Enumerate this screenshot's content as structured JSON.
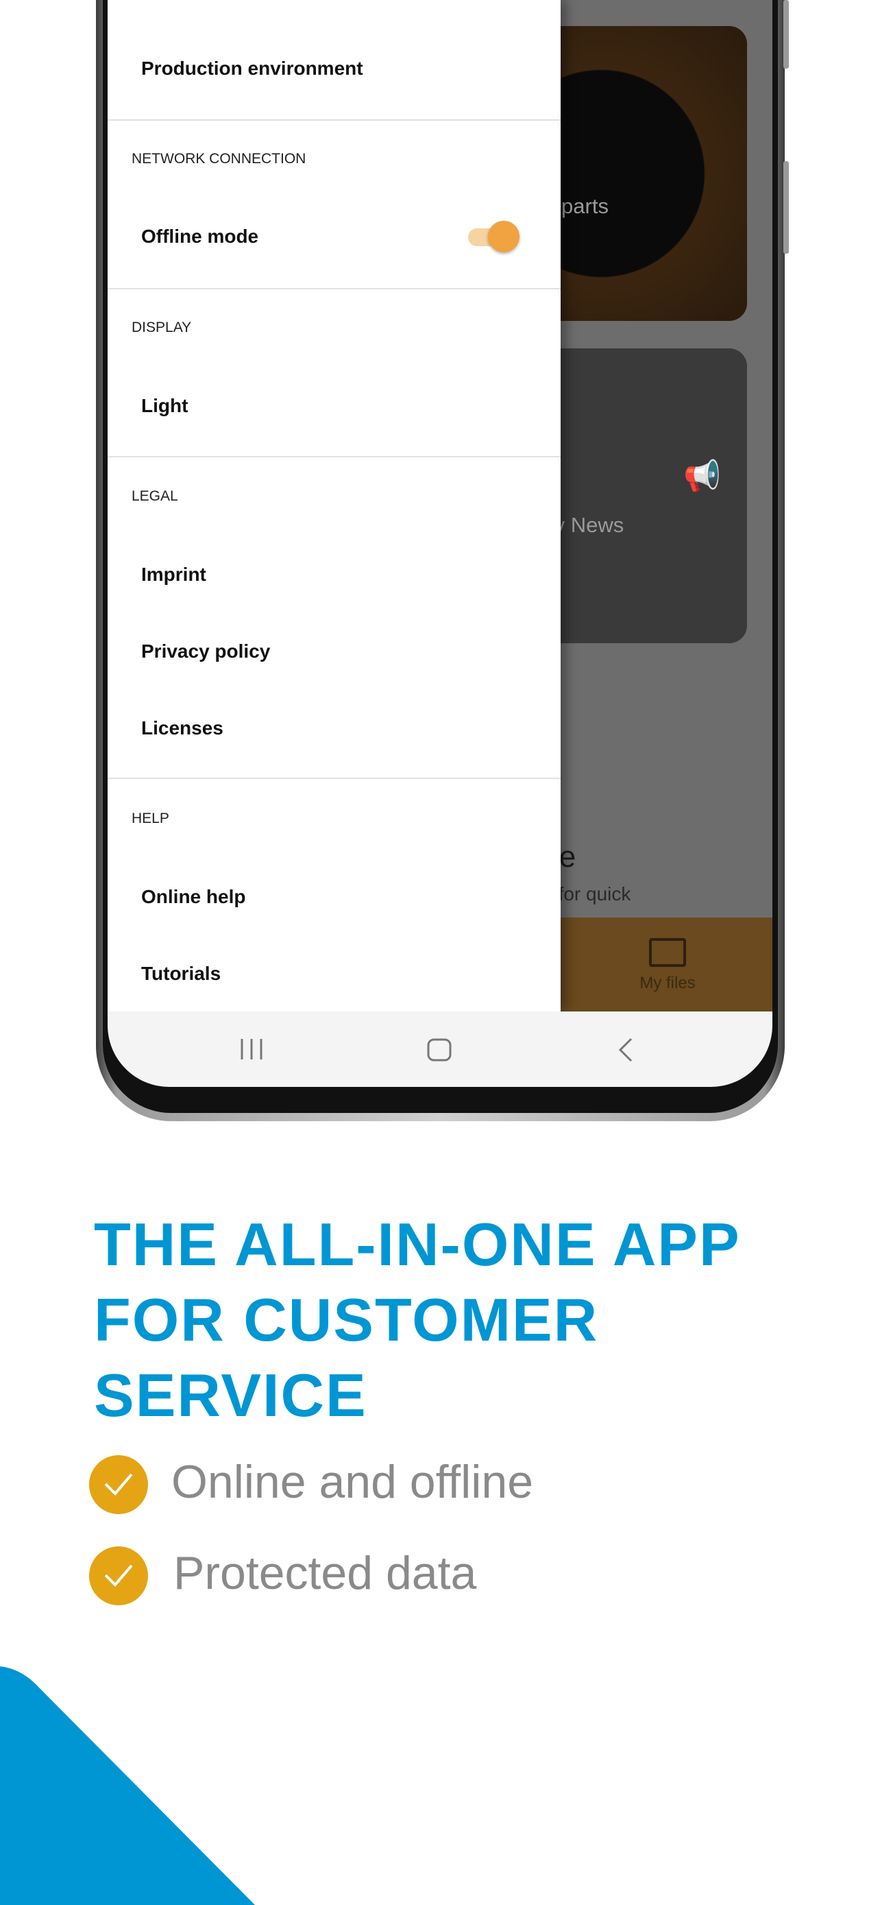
{
  "drawer": {
    "top_item": "Production environment",
    "sections": [
      {
        "header": "NETWORK CONNECTION",
        "items": [
          "Offline mode"
        ]
      },
      {
        "header": "DISPLAY",
        "items": [
          "Light"
        ]
      },
      {
        "header": "LEGAL",
        "items": [
          "Imprint",
          "Privacy policy",
          "Licenses"
        ]
      },
      {
        "header": "HELP",
        "items": [
          "Online help",
          "Tutorials"
        ]
      }
    ],
    "offline_mode_enabled": true
  },
  "background_app": {
    "card1_label": "pareparts",
    "card2_label": "ustry News",
    "partial_title": "able",
    "partial_text": "files for quick",
    "bottom_tab": "My files"
  },
  "navbar": {
    "icons": [
      "recent-apps-icon",
      "home-icon",
      "back-icon"
    ]
  },
  "promo": {
    "heading_lines": [
      "THE ALL-IN-ONE APP",
      "FOR CUSTOMER",
      "SERVICE"
    ],
    "bullets": [
      "Online and offline",
      "Protected data"
    ]
  },
  "colors": {
    "accent_blue": "#0096d3",
    "check_yellow": "#e4a414",
    "toggle_orange": "#f0a340"
  }
}
